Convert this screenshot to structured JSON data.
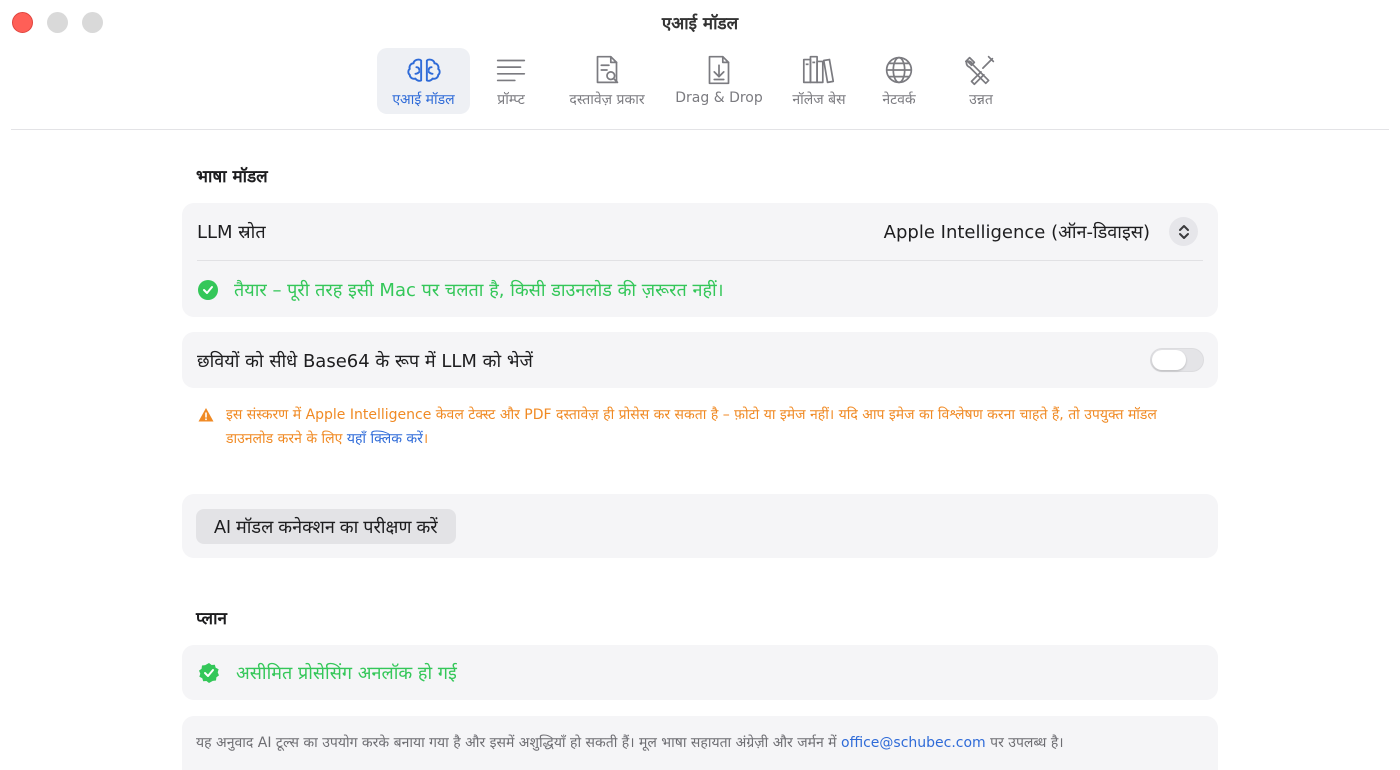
{
  "window": {
    "title": "एआई मॉडल"
  },
  "toolbar": {
    "items": [
      {
        "label": "एआई मॉडल",
        "icon": "brain-icon",
        "active": true
      },
      {
        "label": "प्रॉम्प्ट",
        "icon": "lines-icon",
        "active": false
      },
      {
        "label": "दस्तावेज़ प्रकार",
        "icon": "document-search-icon",
        "active": false
      },
      {
        "label": "Drag & Drop",
        "icon": "download-document-icon",
        "active": false
      },
      {
        "label": "नॉलेज बेस",
        "icon": "books-icon",
        "active": false
      },
      {
        "label": "नेटवर्क",
        "icon": "globe-icon",
        "active": false
      },
      {
        "label": "उन्नत",
        "icon": "tools-icon",
        "active": false
      }
    ]
  },
  "language_model": {
    "section_title": "भाषा मॉडल",
    "llm_source_label": "LLM स्रोत",
    "llm_source_value": "Apple Intelligence (ऑन-डिवाइस)",
    "status_text": "तैयार – पूरी तरह इसी Mac पर चलता है, किसी डाउनलोड की ज़रूरत नहीं।",
    "base64_label": "छवियों को सीधे Base64 के रूप में LLM को भेजें",
    "base64_enabled": false,
    "warning_text": "इस संस्करण में Apple Intelligence केवल टेक्स्ट और PDF दस्तावेज़ ही प्रोसेस कर सकता है – फ़ोटो या इमेज नहीं। यदि आप इमेज का विश्लेषण करना चाहते हैं, तो उपयुक्त मॉडल डाउनलोड करने के लिए ",
    "warning_link": "यहाँ क्लिक करें",
    "warning_end": "।",
    "test_button": "AI मॉडल कनेक्शन का परीक्षण करें"
  },
  "plan": {
    "section_title": "प्लान",
    "status_text": "असीमित प्रोसेसिंग अनलॉक हो गई"
  },
  "footer": {
    "text": "यह अनुवाद AI टूल्स का उपयोग करके बनाया गया है और इसमें अशुद्धियाँ हो सकती हैं। मूल भाषा सहायता अंग्रेज़ी और जर्मन में ",
    "email": "office@schubec.com",
    "text_end": " पर उपलब्ध है।"
  },
  "colors": {
    "accent": "#2f6bd8",
    "success": "#34c759",
    "warning": "#f08a24",
    "close": "#ff5f57"
  }
}
